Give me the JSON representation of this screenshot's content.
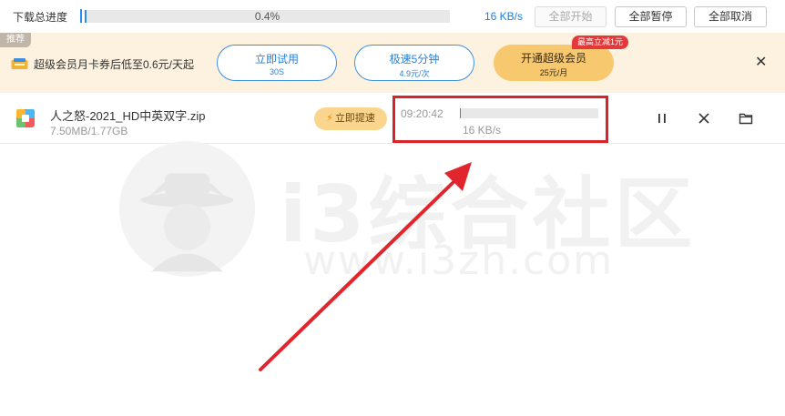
{
  "topbar": {
    "progress_label": "下载总进度",
    "progress_percent": 0.4,
    "progress_text": "0.4%",
    "speed": "16 KB/s",
    "start_all": "全部开始",
    "pause_all": "全部暂停",
    "cancel_all": "全部取消"
  },
  "promo": {
    "tag": "推荐",
    "text": "超级会员月卡券后低至0.6元/天起",
    "trial_label": "立即试用",
    "trial_sub": "30S",
    "speed_label": "极速5分钟",
    "speed_sub": "4.9元/次",
    "vip_label": "开通超级会员",
    "vip_sub": "25元/月",
    "badge": "最高立减1元"
  },
  "task": {
    "file_name": "人之怒-2021_HD中英双字.zip",
    "file_size": "7.50MB/1.77GB",
    "boost_label": "立即提速",
    "remaining_time": "09:20:42",
    "progress_percent": 0.4,
    "speed": "16 KB/s"
  },
  "watermark": {
    "title": "i3综合社区",
    "url": "www.i3zh.com"
  },
  "colors": {
    "accent": "#2d8cf0",
    "banner_bg": "#fdf1e0",
    "vip_gold": "#f7c86e",
    "annotation_red": "#d9232a"
  },
  "icons": {
    "promo": "coupon-icon",
    "file": "zip-archive-icon",
    "pause": "pause-icon",
    "cancel": "close-icon",
    "folder": "folder-icon",
    "boost": "lightning-icon"
  }
}
